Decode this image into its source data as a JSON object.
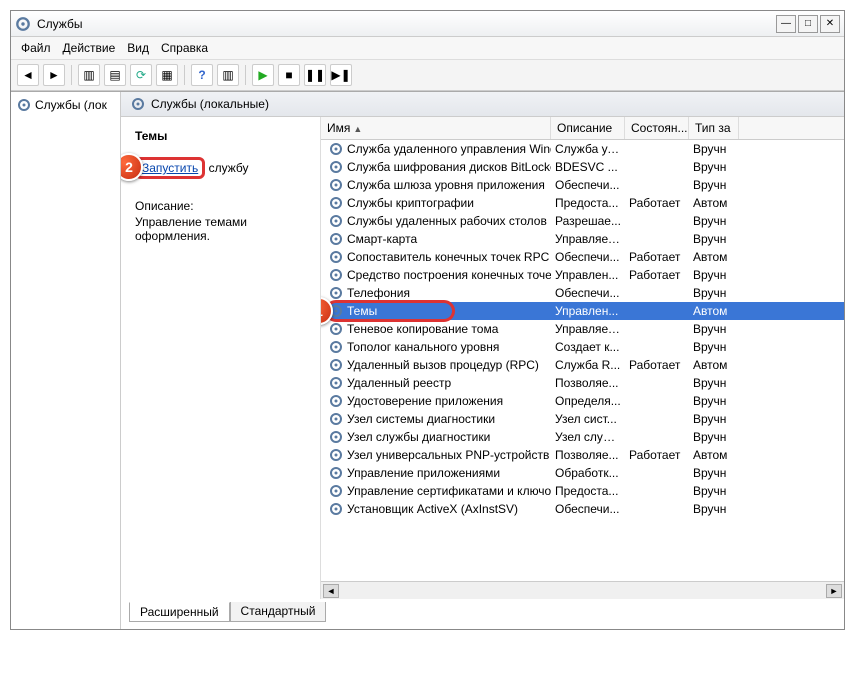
{
  "title": "Службы",
  "menu": {
    "file": "Файл",
    "action": "Действие",
    "view": "Вид",
    "help": "Справка"
  },
  "tree": {
    "root": "Службы (лок"
  },
  "panel_header": "Службы (локальные)",
  "detail": {
    "service_name": "Темы",
    "start_link": "Запустить",
    "start_suffix": " службу",
    "desc_label": "Описание:",
    "desc_text": "Управление темами оформления."
  },
  "columns": {
    "name": "Имя",
    "desc": "Описание",
    "state": "Состоян...",
    "type": "Тип за"
  },
  "tabs": {
    "ext": "Расширенный",
    "std": "Стандартный"
  },
  "badges": {
    "one": "1",
    "two": "2"
  },
  "services": [
    {
      "name": "Служба удаленного управления Wind...",
      "desc": "Служба уд...",
      "state": "",
      "type": "Вручн"
    },
    {
      "name": "Служба шифрования дисков BitLocker",
      "desc": "BDESVC ...",
      "state": "",
      "type": "Вручн"
    },
    {
      "name": "Служба шлюза уровня приложения",
      "desc": "Обеспечи...",
      "state": "",
      "type": "Вручн"
    },
    {
      "name": "Службы криптографии",
      "desc": "Предоста...",
      "state": "Работает",
      "type": "Автом"
    },
    {
      "name": "Службы удаленных рабочих столов",
      "desc": "Разрешае...",
      "state": "",
      "type": "Вручн"
    },
    {
      "name": "Смарт-карта",
      "desc": "Управляет...",
      "state": "",
      "type": "Вручн"
    },
    {
      "name": "Сопоставитель конечных точек RPC",
      "desc": "Обеспечи...",
      "state": "Работает",
      "type": "Автом"
    },
    {
      "name": "Средство построения конечных точек...",
      "desc": "Управлен...",
      "state": "Работает",
      "type": "Вручн"
    },
    {
      "name": "Телефония",
      "desc": "Обеспечи...",
      "state": "",
      "type": "Вручн"
    },
    {
      "name": "Темы",
      "desc": "Управлен...",
      "state": "",
      "type": "Автом",
      "selected": true
    },
    {
      "name": "Теневое копирование тома",
      "desc": "Управляет...",
      "state": "",
      "type": "Вручн"
    },
    {
      "name": "Тополог канального уровня",
      "desc": "Создает к...",
      "state": "",
      "type": "Вручн"
    },
    {
      "name": "Удаленный вызов процедур (RPC)",
      "desc": "Служба R...",
      "state": "Работает",
      "type": "Автом"
    },
    {
      "name": "Удаленный реестр",
      "desc": "Позволяе...",
      "state": "",
      "type": "Вручн"
    },
    {
      "name": "Удостоверение приложения",
      "desc": "Определя...",
      "state": "",
      "type": "Вручн"
    },
    {
      "name": "Узел системы диагностики",
      "desc": "Узел сист...",
      "state": "",
      "type": "Вручн"
    },
    {
      "name": "Узел службы диагностики",
      "desc": "Узел служ...",
      "state": "",
      "type": "Вручн"
    },
    {
      "name": "Узел универсальных PNP-устройств",
      "desc": "Позволяе...",
      "state": "Работает",
      "type": "Автом"
    },
    {
      "name": "Управление приложениями",
      "desc": "Обработк...",
      "state": "",
      "type": "Вручн"
    },
    {
      "name": "Управление сертификатами и ключо...",
      "desc": "Предоста...",
      "state": "",
      "type": "Вручн"
    },
    {
      "name": "Установщик ActiveX (AxInstSV)",
      "desc": "Обеспечи...",
      "state": "",
      "type": "Вручн"
    }
  ]
}
